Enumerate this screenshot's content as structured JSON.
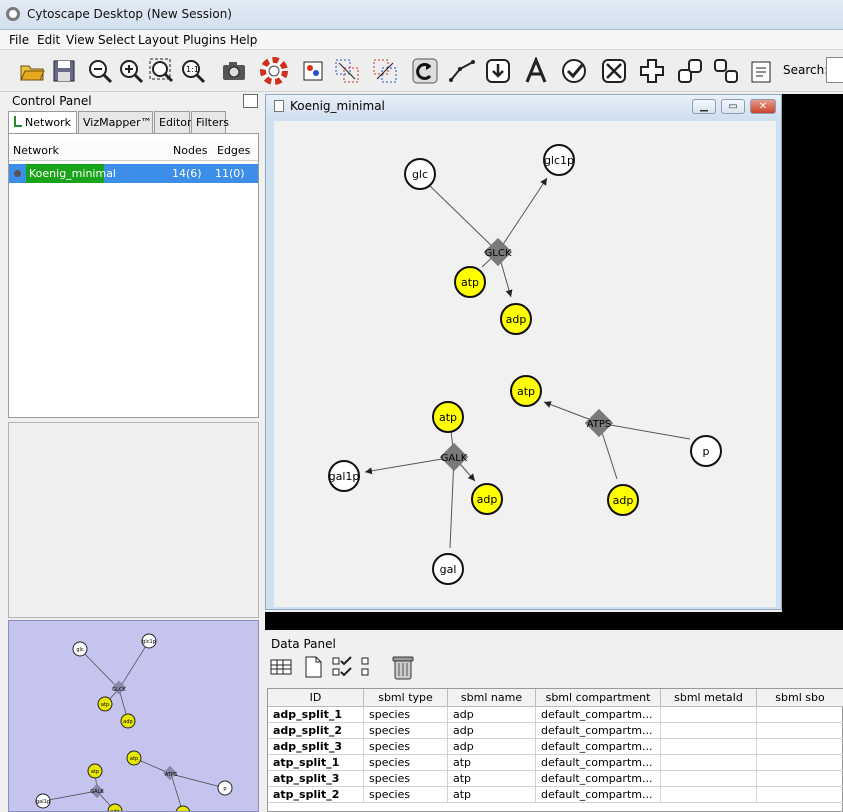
{
  "window": {
    "title": "Cytoscape Desktop (New Session)"
  },
  "menu": [
    "File",
    "Edit",
    "View",
    "Select",
    "Layout",
    "Plugins",
    "Help"
  ],
  "toolbar": {
    "icons": [
      "open-icon",
      "save-icon",
      "zoom-out-icon",
      "zoom-in-icon",
      "zoom-fit-icon",
      "zoom-selected-icon",
      "camera-icon",
      "help-icon",
      "vizmapper-icon",
      "network-from-selection-icon",
      "clone-network-icon",
      "refresh-icon",
      "edge-icon",
      "import-icon",
      "text-icon",
      "check-icon",
      "expand-icon",
      "add-icon",
      "group-icon",
      "ungroup-icon",
      "report-icon"
    ],
    "search_label": "Search:",
    "search_value": ""
  },
  "control_panel": {
    "title": "Control Panel",
    "tabs": [
      "Network",
      "VizMapper™",
      "Editor",
      "Filters"
    ],
    "network_table": {
      "headers": [
        "Network",
        "Nodes",
        "Edges"
      ],
      "rows": [
        {
          "name": "Koenig_minimal",
          "nodes": "14(6)",
          "edges": "11(0)"
        }
      ]
    }
  },
  "network_window": {
    "title": "Koenig_minimal",
    "nodes": [
      {
        "label": "glc",
        "kind": "species",
        "color": "#ffffff"
      },
      {
        "label": "glc1p",
        "kind": "species",
        "color": "#ffffff"
      },
      {
        "label": "GLCK",
        "kind": "reaction"
      },
      {
        "label": "atp",
        "kind": "species",
        "color": "#ffff00"
      },
      {
        "label": "adp",
        "kind": "species",
        "color": "#ffff00"
      },
      {
        "label": "atp",
        "kind": "species",
        "color": "#ffff00"
      },
      {
        "label": "ATPS",
        "kind": "reaction"
      },
      {
        "label": "p",
        "kind": "species",
        "color": "#ffffff"
      },
      {
        "label": "adp",
        "kind": "species",
        "color": "#ffff00"
      },
      {
        "label": "atp",
        "kind": "species",
        "color": "#ffff00"
      },
      {
        "label": "GALK",
        "kind": "reaction"
      },
      {
        "label": "gal1p",
        "kind": "species",
        "color": "#ffffff"
      },
      {
        "label": "adp",
        "kind": "species",
        "color": "#ffff00"
      },
      {
        "label": "gal",
        "kind": "species",
        "color": "#ffffff"
      }
    ]
  },
  "data_panel": {
    "title": "Data Panel",
    "headers": [
      "ID",
      "sbml type",
      "sbml name",
      "sbml compartment",
      "sbml metaId",
      "sbml sbo"
    ],
    "rows": [
      [
        "adp_split_1",
        "species",
        "adp",
        "default_compartm...",
        "",
        ""
      ],
      [
        "adp_split_2",
        "species",
        "adp",
        "default_compartm...",
        "",
        ""
      ],
      [
        "adp_split_3",
        "species",
        "adp",
        "default_compartm...",
        "",
        ""
      ],
      [
        "atp_split_1",
        "species",
        "atp",
        "default_compartm...",
        "",
        ""
      ],
      [
        "atp_split_3",
        "species",
        "atp",
        "default_compartm...",
        "",
        ""
      ],
      [
        "atp_split_2",
        "species",
        "atp",
        "default_compartm...",
        "",
        ""
      ]
    ]
  },
  "colors": {
    "accent": "#3d8ee8",
    "selected_network": "#19a319",
    "species_yellow": "#ffff00",
    "navigator_bg": "#c4c4ef"
  }
}
